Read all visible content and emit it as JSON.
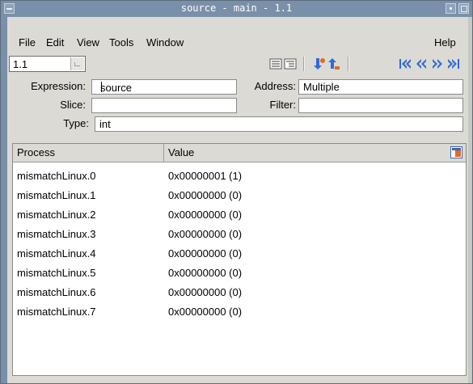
{
  "window": {
    "title": "source - main - 1.1"
  },
  "menu": {
    "file": "File",
    "edit": "Edit",
    "view": "View",
    "tools": "Tools",
    "window": "Window",
    "help": "Help"
  },
  "toolbar": {
    "thread_value": "1.1",
    "icons": [
      "list-icon",
      "list-indent-icon",
      "dive-icon",
      "up-icon",
      "first-icon",
      "previous-icon",
      "next-icon",
      "last-icon"
    ]
  },
  "form": {
    "expression_label": "Expression:",
    "expression_value": "source",
    "address_label": "Address:",
    "address_value": "Multiple",
    "slice_label": "Slice:",
    "slice_value": "",
    "filter_label": "Filter:",
    "filter_value": "",
    "type_label": "Type:",
    "type_value": "int"
  },
  "table": {
    "headers": [
      "Process",
      "Value"
    ],
    "rows": [
      {
        "process": "mismatchLinux.0",
        "value": "0x00000001 (1)"
      },
      {
        "process": "mismatchLinux.1",
        "value": "0x00000000 (0)"
      },
      {
        "process": "mismatchLinux.2",
        "value": "0x00000000 (0)"
      },
      {
        "process": "mismatchLinux.3",
        "value": "0x00000000 (0)"
      },
      {
        "process": "mismatchLinux.4",
        "value": "0x00000000 (0)"
      },
      {
        "process": "mismatchLinux.5",
        "value": "0x00000000 (0)"
      },
      {
        "process": "mismatchLinux.6",
        "value": "0x00000000 (0)"
      },
      {
        "process": "mismatchLinux.7",
        "value": "0x00000000 (0)"
      }
    ]
  },
  "colors": {
    "titlebar": "#7a90aa",
    "window_bg": "#dcdad5",
    "nav_blue": "#2f6bd8",
    "dive_orange": "#e06a2a"
  }
}
